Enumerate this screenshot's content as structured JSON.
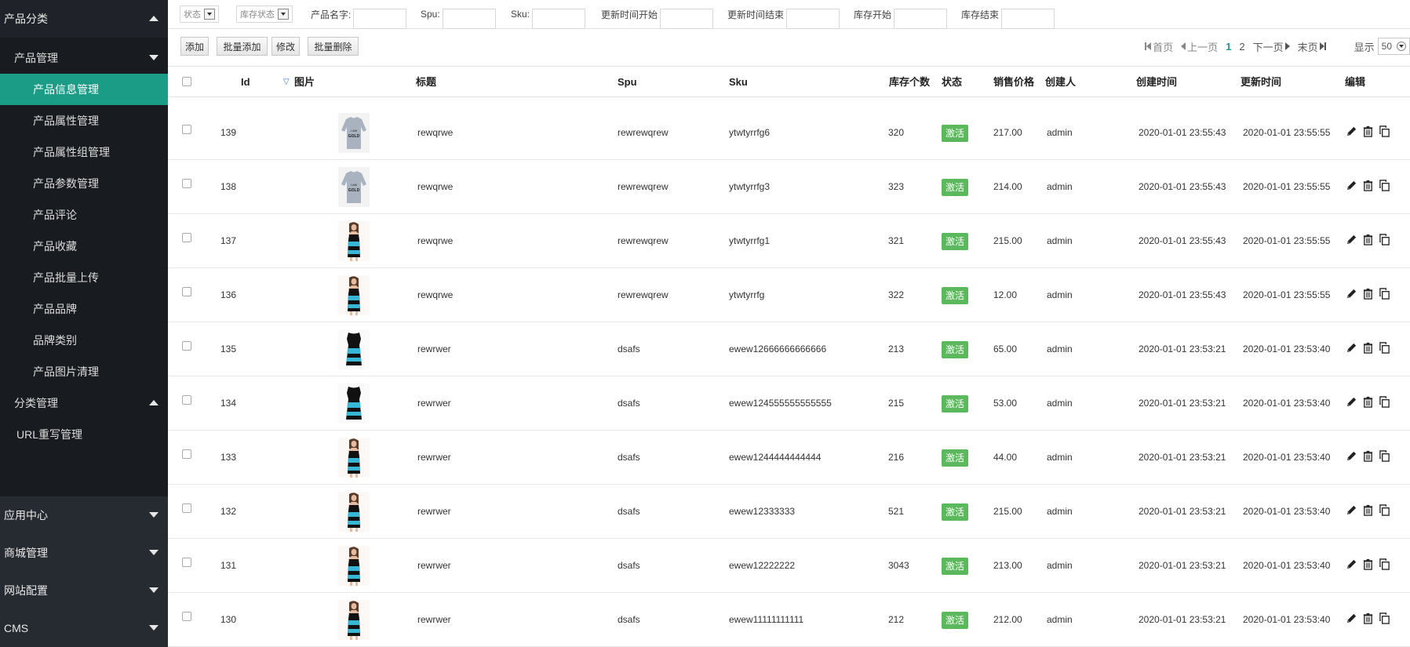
{
  "sidebar": {
    "top_section": "产品分类",
    "group1": "产品管理",
    "items": [
      "产品信息管理",
      "产品属性管理",
      "产品属性组管理",
      "产品参数管理",
      "产品评论",
      "产品收藏",
      "产品批量上传",
      "产品品牌",
      "品牌类别",
      "产品图片清理"
    ],
    "group2": "分类管理",
    "group3": "URL重写管理",
    "bottom_sections": [
      "应用中心",
      "商城管理",
      "网站配置",
      "CMS"
    ]
  },
  "filters": {
    "status": "状态",
    "stock_status": "库存状态",
    "name_label": "产品名字:",
    "spu_label": "Spu:",
    "sku_label": "Sku:",
    "updated_start": "更新时间开始",
    "updated_end": "更新时间结束",
    "stock_start": "库存开始",
    "stock_end": "库存结束"
  },
  "toolbar": {
    "add": "添加",
    "batch_add": "批量添加",
    "edit": "修改",
    "batch_delete": "批量删除"
  },
  "pager": {
    "first": "首页",
    "prev": "上一页",
    "page1": "1",
    "page2": "2",
    "next": "下一页",
    "last": "末页",
    "show_label": "显示",
    "per_page": "50"
  },
  "table": {
    "headers": {
      "id": "Id",
      "image": "图片",
      "title": "标题",
      "spu": "Spu",
      "sku": "Sku",
      "stock": "库存个数",
      "status": "状态",
      "price": "销售价格",
      "creator": "创建人",
      "created": "创建时间",
      "updated": "更新时间",
      "edit": "编辑"
    },
    "rows": [
      {
        "id": "139",
        "img": "sweater",
        "title": "rewqrwe",
        "spu": "rewrewqrew",
        "sku": "ytwtyrrfg6",
        "stock": "320",
        "status": "激活",
        "price": "217.00",
        "creator": "admin",
        "created": "2020-01-01 23:55:43",
        "updated": "2020-01-01 23:55:55"
      },
      {
        "id": "138",
        "img": "sweater",
        "title": "rewqrwe",
        "spu": "rewrewqrew",
        "sku": "ytwtyrrfg3",
        "stock": "323",
        "status": "激活",
        "price": "214.00",
        "creator": "admin",
        "created": "2020-01-01 23:55:43",
        "updated": "2020-01-01 23:55:55"
      },
      {
        "id": "137",
        "img": "dress-model",
        "title": "rewqrwe",
        "spu": "rewrewqrew",
        "sku": "ytwtyrrfg1",
        "stock": "321",
        "status": "激活",
        "price": "215.00",
        "creator": "admin",
        "created": "2020-01-01 23:55:43",
        "updated": "2020-01-01 23:55:55"
      },
      {
        "id": "136",
        "img": "dress-model",
        "title": "rewqrwe",
        "spu": "rewrewqrew",
        "sku": "ytwtyrrfg",
        "stock": "322",
        "status": "激活",
        "price": "12.00",
        "creator": "admin",
        "created": "2020-01-01 23:55:43",
        "updated": "2020-01-01 23:55:55"
      },
      {
        "id": "135",
        "img": "dress",
        "title": "rewrwer",
        "spu": "dsafs",
        "sku": "ewew12666666666666",
        "stock": "213",
        "status": "激活",
        "price": "65.00",
        "creator": "admin",
        "created": "2020-01-01 23:53:21",
        "updated": "2020-01-01 23:53:40"
      },
      {
        "id": "134",
        "img": "dress",
        "title": "rewrwer",
        "spu": "dsafs",
        "sku": "ewew124555555555555",
        "stock": "215",
        "status": "激活",
        "price": "53.00",
        "creator": "admin",
        "created": "2020-01-01 23:53:21",
        "updated": "2020-01-01 23:53:40"
      },
      {
        "id": "133",
        "img": "dress-model",
        "title": "rewrwer",
        "spu": "dsafs",
        "sku": "ewew1244444444444",
        "stock": "216",
        "status": "激活",
        "price": "44.00",
        "creator": "admin",
        "created": "2020-01-01 23:53:21",
        "updated": "2020-01-01 23:53:40"
      },
      {
        "id": "132",
        "img": "dress-model",
        "title": "rewrwer",
        "spu": "dsafs",
        "sku": "ewew12333333",
        "stock": "521",
        "status": "激活",
        "price": "215.00",
        "creator": "admin",
        "created": "2020-01-01 23:53:21",
        "updated": "2020-01-01 23:53:40"
      },
      {
        "id": "131",
        "img": "dress-model",
        "title": "rewrwer",
        "spu": "dsafs",
        "sku": "ewew12222222",
        "stock": "3043",
        "status": "激活",
        "price": "213.00",
        "creator": "admin",
        "created": "2020-01-01 23:53:21",
        "updated": "2020-01-01 23:53:40"
      },
      {
        "id": "130",
        "img": "dress-model",
        "title": "rewrwer",
        "spu": "dsafs",
        "sku": "ewew11111111111",
        "stock": "212",
        "status": "激活",
        "price": "212.00",
        "creator": "admin",
        "created": "2020-01-01 23:53:21",
        "updated": "2020-01-01 23:53:40"
      }
    ]
  },
  "colors": {
    "accent": "#1a9c86",
    "sidebar_bg": "#1f2329",
    "status_green": "#5cb85c"
  }
}
